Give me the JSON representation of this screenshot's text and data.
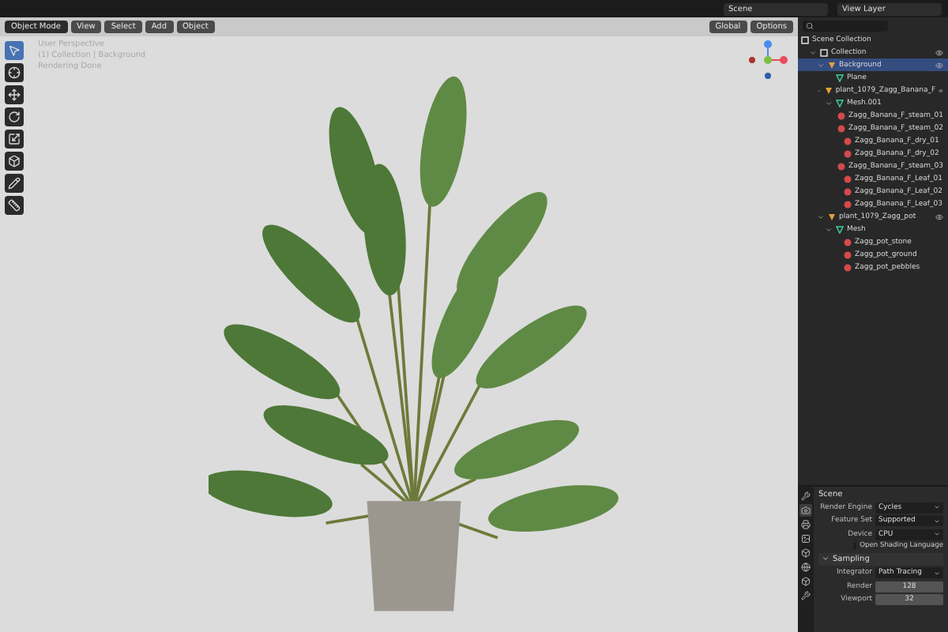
{
  "topbar": {
    "scene": "Scene",
    "view_layer": "View Layer"
  },
  "header": {
    "mode": "Object Mode",
    "menus": [
      "View",
      "Select",
      "Add",
      "Object"
    ],
    "orientation": "Global",
    "options": "Options"
  },
  "overlay_text": [
    "User Perspective",
    "(1) Collection | Background",
    "Rendering Done"
  ],
  "tools": [
    {
      "kind": "select",
      "selected": true
    },
    {
      "kind": "cursor",
      "selected": false
    },
    {
      "kind": "move",
      "selected": false
    },
    {
      "kind": "rotate",
      "selected": false
    },
    {
      "kind": "scale",
      "selected": false
    },
    {
      "kind": "transform",
      "selected": false
    },
    {
      "kind": "annotate",
      "selected": false
    },
    {
      "kind": "measure",
      "selected": false
    }
  ],
  "outliner": {
    "root": "Scene Collection",
    "items": [
      {
        "kind": "collection",
        "label": "Collection",
        "expanded": true,
        "selected": false,
        "children": [
          {
            "kind": "object",
            "label": "Background",
            "expanded": true,
            "selected": true,
            "children": [
              {
                "kind": "mesh",
                "label": "Plane",
                "selected": false
              }
            ]
          },
          {
            "kind": "object",
            "label": "plant_1079_Zagg_Banana_F",
            "expanded": true,
            "selected": false,
            "children": [
              {
                "kind": "mesh",
                "label": "Mesh.001",
                "expanded": true,
                "selected": false,
                "children": [
                  {
                    "kind": "material",
                    "label": "Zagg_Banana_F_steam_01",
                    "selected": false
                  },
                  {
                    "kind": "material",
                    "label": "Zagg_Banana_F_steam_02",
                    "selected": false
                  },
                  {
                    "kind": "material",
                    "label": "Zagg_Banana_F_dry_01",
                    "selected": false
                  },
                  {
                    "kind": "material",
                    "label": "Zagg_Banana_F_dry_02",
                    "selected": false
                  },
                  {
                    "kind": "material",
                    "label": "Zagg_Banana_F_steam_03",
                    "selected": false
                  },
                  {
                    "kind": "material",
                    "label": "Zagg_Banana_F_Leaf_01",
                    "selected": false
                  },
                  {
                    "kind": "material",
                    "label": "Zagg_Banana_F_Leaf_02",
                    "selected": false
                  },
                  {
                    "kind": "material",
                    "label": "Zagg_Banana_F_Leaf_03",
                    "selected": false
                  }
                ]
              }
            ]
          },
          {
            "kind": "object",
            "label": "plant_1079_Zagg_pot",
            "expanded": true,
            "selected": false,
            "children": [
              {
                "kind": "mesh",
                "label": "Mesh",
                "expanded": true,
                "selected": false,
                "children": [
                  {
                    "kind": "material",
                    "label": "Zagg_pot_stone",
                    "selected": false
                  },
                  {
                    "kind": "material",
                    "label": "Zagg_pot_ground",
                    "selected": false
                  },
                  {
                    "kind": "material",
                    "label": "Zagg_pot_pebbles",
                    "selected": false
                  }
                ]
              }
            ]
          }
        ]
      }
    ]
  },
  "properties": {
    "tabs": [
      {
        "kind": "tool",
        "selected": false
      },
      {
        "kind": "render",
        "selected": true
      },
      {
        "kind": "output",
        "selected": false
      },
      {
        "kind": "view",
        "selected": false
      },
      {
        "kind": "scene",
        "selected": false
      },
      {
        "kind": "world",
        "selected": false
      },
      {
        "kind": "object",
        "selected": false
      },
      {
        "kind": "modifier",
        "selected": false
      }
    ],
    "title": "Scene",
    "fields": [
      {
        "label": "Render Engine",
        "value": "Cycles"
      },
      {
        "label": "Feature Set",
        "value": "Supported"
      },
      {
        "label": "Device",
        "value": "CPU"
      }
    ],
    "checkbox": {
      "label": "Open Shading Language",
      "checked": false
    },
    "section": {
      "title": "Sampling",
      "expanded": true
    },
    "integrator": {
      "label": "Integrator",
      "value": "Path Tracing"
    },
    "samples": [
      {
        "label": "Render",
        "value": "128"
      },
      {
        "label": "Viewport",
        "value": "32"
      }
    ]
  }
}
